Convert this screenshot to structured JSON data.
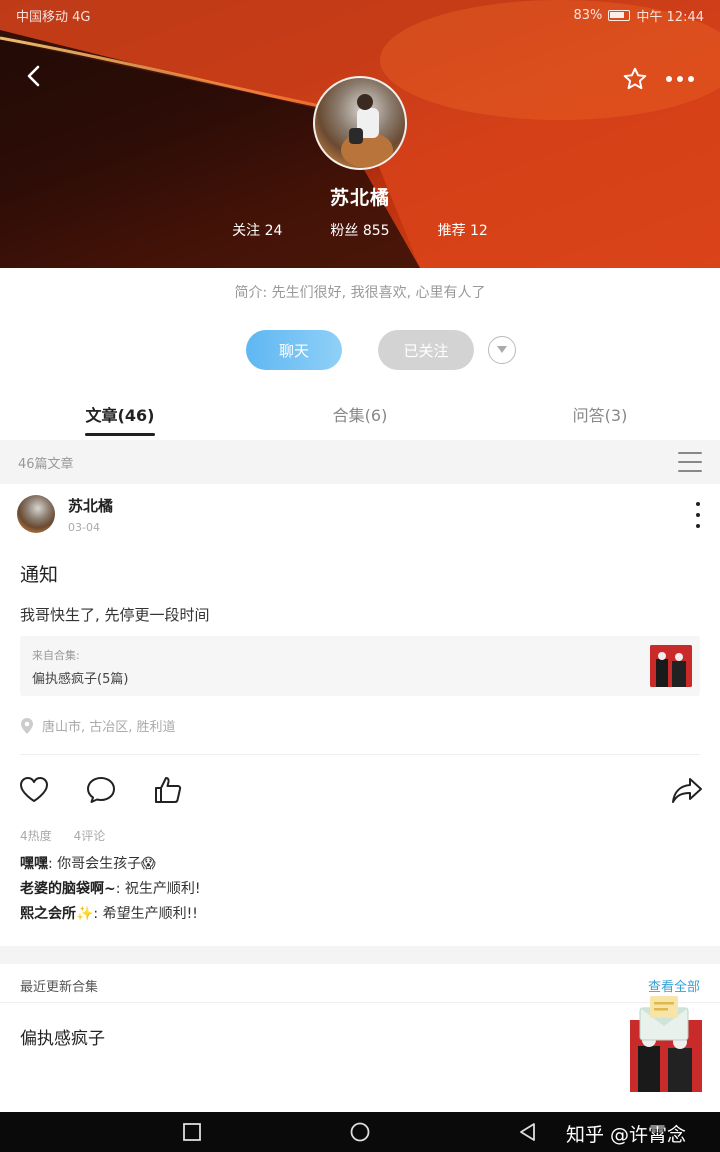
{
  "status_bar": {
    "carrier": "中国移动 4G",
    "battery": "83%",
    "time": "中午 12:44"
  },
  "header": {
    "back_icon": "chevron-left-icon",
    "favorite_icon": "star-outline-icon",
    "more_icon": "more-dots-icon"
  },
  "profile": {
    "name": "苏北橘",
    "following": "关注 24",
    "followers": "粉丝 855",
    "recommend": "推荐 12",
    "bio": "简介: 先生们很好, 我很喜欢, 心里有人了",
    "chat_label": "聊天",
    "follow_label": "已关注"
  },
  "tabs": [
    {
      "label": "文章(46)",
      "active": true
    },
    {
      "label": "合集(6)",
      "active": false
    },
    {
      "label": "问答(3)",
      "active": false
    }
  ],
  "article_count": "46篇文章",
  "post": {
    "author": "苏北橘",
    "date": "03-04",
    "title": "通知",
    "body": "我哥快生了, 先停更一段时间",
    "collection_label": "来自合集:",
    "collection_name": "偏执感疯子(5篇)",
    "location": "唐山市, 古冶区, 胜利道",
    "heat": "4热度",
    "comment_count": "4评论",
    "comments": [
      {
        "user": "嘿嘿",
        "text": ": 你哥会生孩子😱"
      },
      {
        "user": "老婆的脑袋啊~",
        "text": ": 祝生产顺利!"
      },
      {
        "user": "熙之会所",
        "text": "✨: 希望生产顺利!!"
      }
    ]
  },
  "recent": {
    "heading": "最近更新合集",
    "view_all": "查看全部",
    "collection_name": "偏执感疯子"
  },
  "watermark": "知乎 @许霄念",
  "colors": {
    "chat_button": "#5fb7f2",
    "follow_button": "#d3d3d3",
    "link": "#39a0d6",
    "cover_red": "#e04a16"
  }
}
